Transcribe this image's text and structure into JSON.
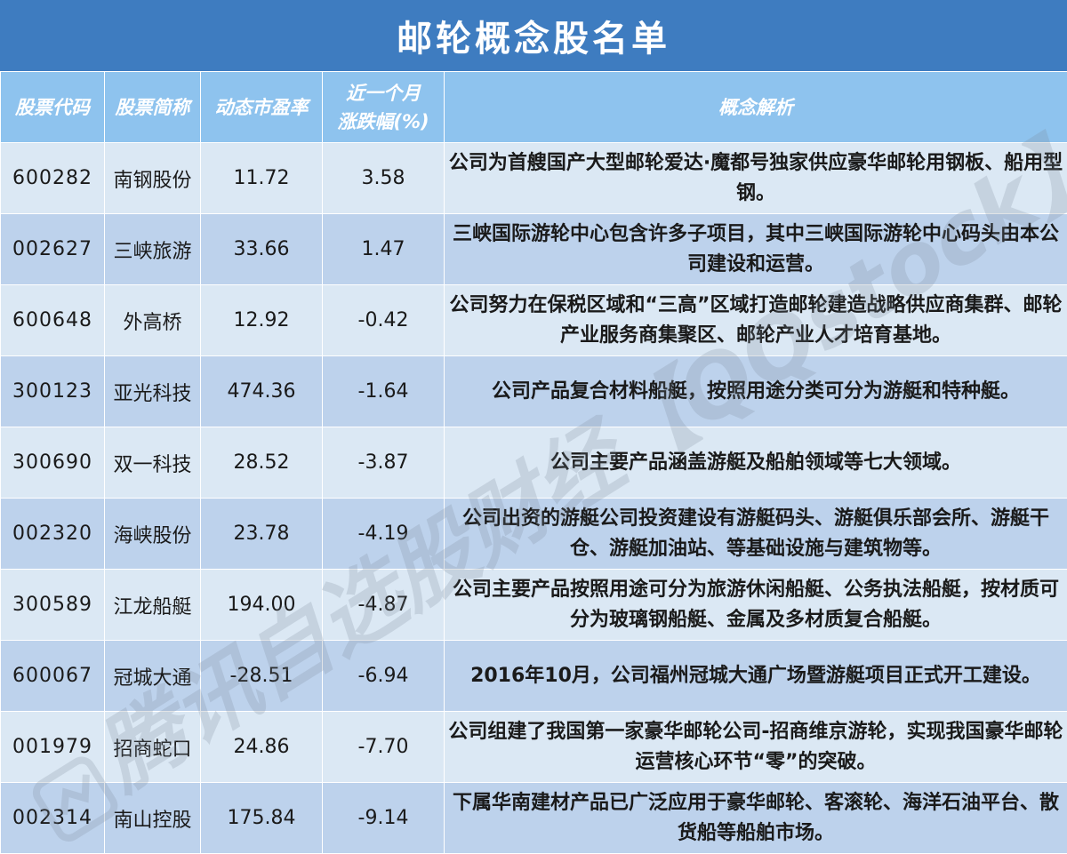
{
  "title": "邮轮概念股名单",
  "headers": {
    "code": "股票代码",
    "name": "股票简称",
    "pe": "动态市盈率",
    "change_line1": "近一个月",
    "change_line2": "涨跌幅(%)",
    "desc": "概念解析"
  },
  "rows": [
    {
      "code": "600282",
      "name": "南钢股份",
      "pe": "11.72",
      "change": "3.58",
      "desc": "公司为首艘国产大型邮轮爱达·魔都号独家供应豪华邮轮用钢板、船用型钢。"
    },
    {
      "code": "002627",
      "name": "三峡旅游",
      "pe": "33.66",
      "change": "1.47",
      "desc": "三峡国际游轮中心包含许多子项目，其中三峡国际游轮中心码头由本公司建设和运营。"
    },
    {
      "code": "600648",
      "name": "外高桥",
      "pe": "12.92",
      "change": "-0.42",
      "desc": "公司努力在保税区域和“三高”区域打造邮轮建造战略供应商集群、邮轮产业服务商集聚区、邮轮产业人才培育基地。"
    },
    {
      "code": "300123",
      "name": "亚光科技",
      "pe": "474.36",
      "change": "-1.64",
      "desc": "公司产品复合材料船艇，按照用途分类可分为游艇和特种艇。"
    },
    {
      "code": "300690",
      "name": "双一科技",
      "pe": "28.52",
      "change": "-3.87",
      "desc": "公司主要产品涵盖游艇及船舶领域等七大领域。"
    },
    {
      "code": "002320",
      "name": "海峡股份",
      "pe": "23.78",
      "change": "-4.19",
      "desc": "公司出资的游艇公司投资建设有游艇码头、游艇俱乐部会所、游艇干仓、游艇加油站、等基础设施与建筑物等。"
    },
    {
      "code": "300589",
      "name": "江龙船艇",
      "pe": "194.00",
      "change": "-4.87",
      "desc": "公司主要产品按照用途可分为旅游休闲船艇、公务执法船艇，按材质可分为玻璃钢船艇、金属及多材质复合船艇。"
    },
    {
      "code": "600067",
      "name": "冠城大通",
      "pe": "-28.51",
      "change": "-6.94",
      "desc": "2016年10月，公司福州冠城大通广场暨游艇项目正式开工建设。"
    },
    {
      "code": "001979",
      "name": "招商蛇口",
      "pe": "24.86",
      "change": "-7.70",
      "desc": "公司组建了我国第一家豪华邮轮公司-招商维京游轮，实现我国豪华邮轮运营核心环节“零”的突破。"
    },
    {
      "code": "002314",
      "name": "南山控股",
      "pe": "175.84",
      "change": "-9.14",
      "desc": "下属华南建材产品已广泛应用于豪华邮轮、客滚轮、海洋石油平台、散货船等船舶市场。"
    }
  ],
  "watermark": "腾讯自选股财经【QQstock】",
  "colors": {
    "positive": "#e0202a",
    "negative": "#1f9e3a",
    "title_bg": "#3e7cc0",
    "header_bg": "#8ec3ee"
  }
}
